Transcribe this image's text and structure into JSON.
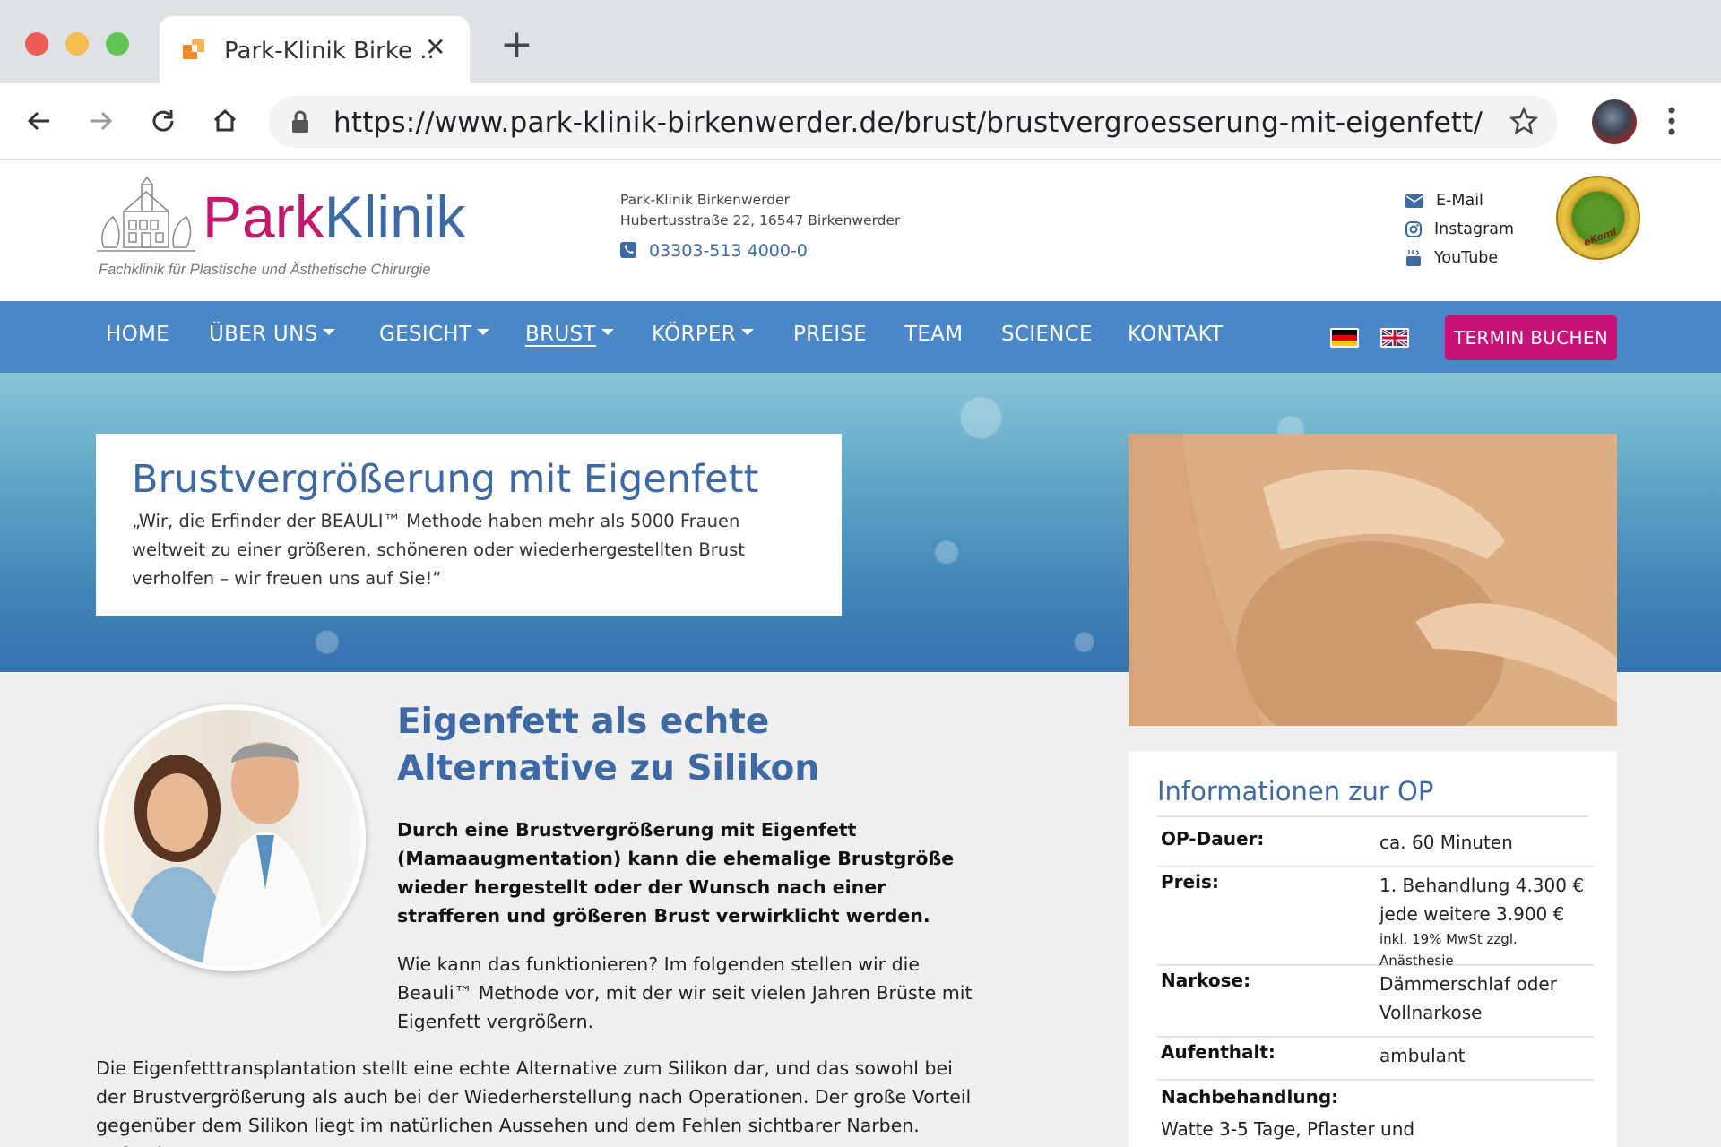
{
  "browser": {
    "tab_title": "Park-Klinik Birke ..",
    "url": "https://www.park-klinik-birkenwerder.de/brust/brustvergroesserung-mit-eigenfett/"
  },
  "header": {
    "logo_park": "Park",
    "logo_klinik": "Klinik",
    "logo_subtitle": "Fachklinik für Plastische und Ästhetische Chirurgie",
    "address_line1": "Park-Klinik Birkenwerder",
    "address_line2": "Hubertusstraße 22, 16547 Birkenwerder",
    "phone": "03303-513 4000-0",
    "links": {
      "email": "E-Mail",
      "instagram": "Instagram",
      "youtube": "YouTube"
    },
    "badge_text": "eKomi"
  },
  "nav": {
    "items": [
      "HOME",
      "ÜBER UNS",
      "GESICHT",
      "BRUST",
      "KÖRPER",
      "PREISE",
      "TEAM",
      "SCIENCE",
      "KONTAKT"
    ],
    "cta": "TERMIN BUCHEN"
  },
  "hero": {
    "title": "Brustvergrößerung mit Eigenfett",
    "quote": "„Wir, die Erfinder der BEAULI™ Methode haben mehr als 5000 Frauen weltweit zu einer größeren, schöneren oder wiederhergestellten Brust verholfen – wir freuen uns auf Sie!“"
  },
  "main": {
    "section_title": "Eigenfett als echte Alternative zu Silikon",
    "lead": "Durch eine Brustvergrößerung mit Eigenfett (Mamaaugmentation) kann die ehemalige Brustgröße wieder hergestellt oder der Wunsch nach einer strafferen und größeren Brust verwirklicht werden.",
    "para1": "Wie kann das funktionieren? Im folgenden stellen wir die Beauli™ Methode vor, mit der wir seit vielen Jahren Brüste mit Eigenfett vergrößern.",
    "para2": "Die Eigenfetttransplantation stellt eine echte Alternative zum Silikon dar, und das sowohl bei der Brustvergrößerung als auch bei der Wiederherstellung nach Operationen. Der große Vorteil gegenüber dem Silikon liegt im natürlichen Aussehen und dem Fehlen sichtbarer Narben. Außerdem"
  },
  "info": {
    "title": "Informationen zur OP",
    "rows": [
      {
        "label": "OP-Dauer:",
        "value": "ca. 60 Minuten"
      },
      {
        "label": "Preis:",
        "value": "1. Behandlung 4.300 €",
        "value2": "jede weitere 3.900 €",
        "note": "inkl. 19% MwSt zzgl. Anästhesie"
      },
      {
        "label": "Narkose:",
        "value": "Dämmerschlaf oder Vollnarkose"
      },
      {
        "label": "Aufenthalt:",
        "value": "ambulant"
      },
      {
        "label": "Nachbehandlung:",
        "value": "Watte 3-5 Tage, Pflaster und"
      }
    ]
  },
  "colors": {
    "brand_blue": "#3d6aa4",
    "nav_blue": "#4b87c7",
    "brand_magenta": "#c8127a"
  }
}
